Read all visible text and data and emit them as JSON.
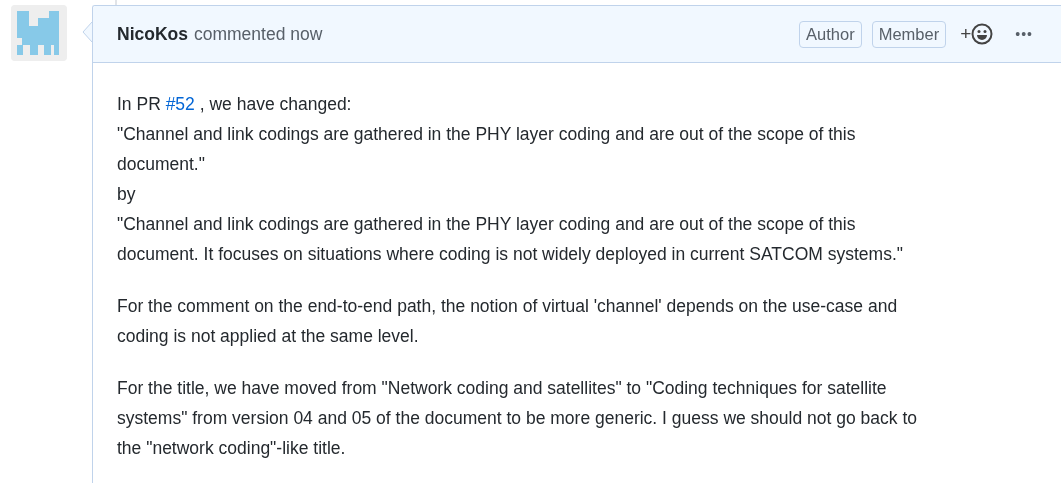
{
  "comment": {
    "author": "NicoKos",
    "action": "commented now",
    "badges": [
      "Author",
      "Member"
    ],
    "reaction": "+",
    "more": "•••",
    "paragraphs": [
      {
        "before": "In PR ",
        "link": "#52",
        "after": " , we have changed:\n\"Channel and link codings are gathered in the PHY layer coding and are out of the scope of this\ndocument.\"\nby\n\"Channel and link codings are gathered in the PHY layer coding and are out of the scope of this\ndocument. It focuses on situations where coding is not widely deployed in current SATCOM systems.\""
      },
      {
        "text": "For the comment on the end-to-end path, the notion of virtual 'channel' depends on the use-case and\ncoding is not applied at the same level."
      },
      {
        "text": "For the title, we have moved from \"Network coding and satellites\" to \"Coding techniques for satellite\nsystems\" from version 04 and 05 of the document to be more generic. I guess we should not go back to\nthe \"network coding\"-like title."
      }
    ]
  }
}
